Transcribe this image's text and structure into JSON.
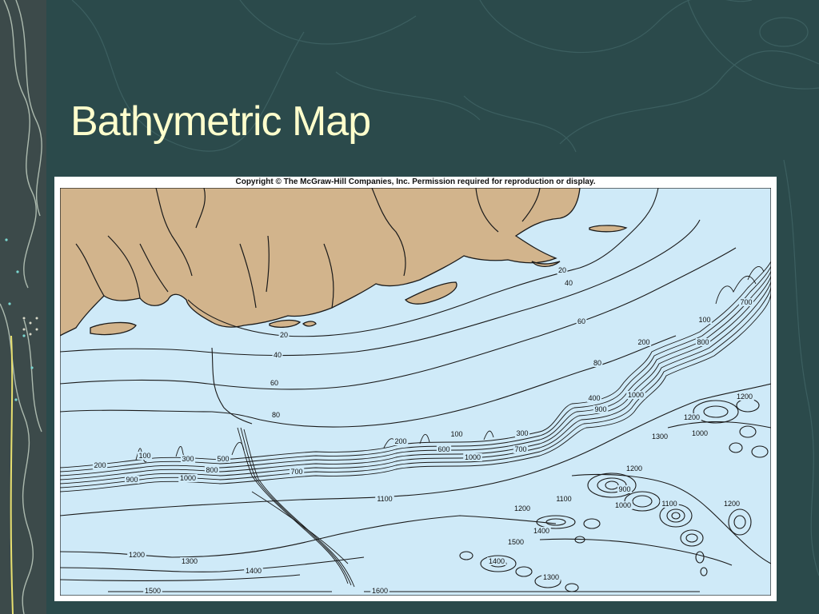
{
  "slide": {
    "title": "Bathymetric Map",
    "background_color": "#2b4a4b",
    "title_color": "#ffffcc"
  },
  "figure": {
    "copyright": "Copyright © The McGraw-Hill Companies, Inc. Permission required for reproduction or display.",
    "water_color": "#cfeaf8",
    "land_color": "#d2b48c"
  },
  "depth_labels": [
    "20",
    "40",
    "60",
    "80",
    "100",
    "200",
    "300",
    "400",
    "500",
    "600",
    "700",
    "800",
    "900",
    "1000",
    "1100",
    "1200",
    "1300",
    "1400",
    "1500",
    "1600"
  ]
}
